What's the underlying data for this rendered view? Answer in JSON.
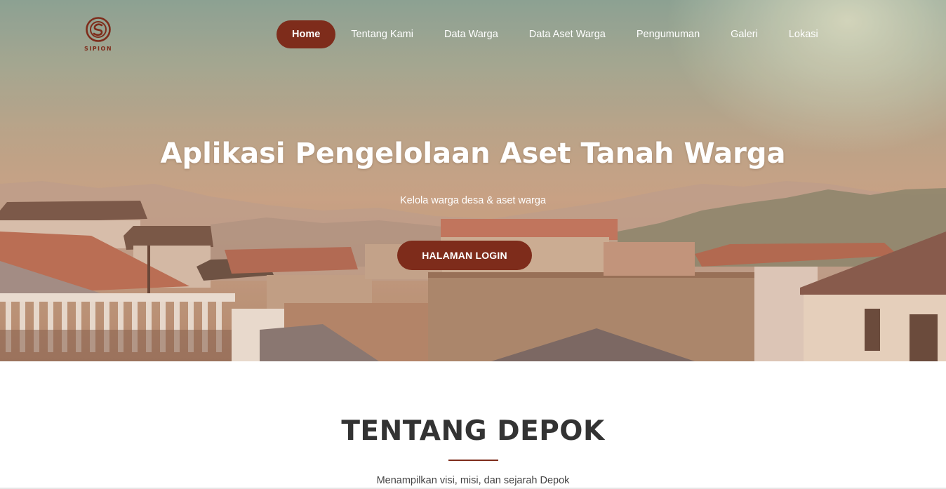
{
  "brand": {
    "name": "SIPION",
    "color": "#7e2c1b"
  },
  "nav": {
    "items": [
      {
        "label": "Home",
        "active": true
      },
      {
        "label": "Tentang Kami",
        "active": false
      },
      {
        "label": "Data Warga",
        "active": false
      },
      {
        "label": "Data Aset Warga",
        "active": false
      },
      {
        "label": "Pengumuman",
        "active": false
      },
      {
        "label": "Galeri",
        "active": false
      },
      {
        "label": "Lokasi",
        "active": false
      }
    ]
  },
  "hero": {
    "title": "Aplikasi Pengelolaan Aset Tanah Warga",
    "subtitle": "Kelola warga desa & aset warga",
    "button_label": "HALAMAN LOGIN"
  },
  "about": {
    "title": "TENTANG DEPOK",
    "description": "Menampilkan visi, misi, dan sejarah Depok"
  },
  "icons": {
    "logo": "sipion-logo-icon"
  }
}
